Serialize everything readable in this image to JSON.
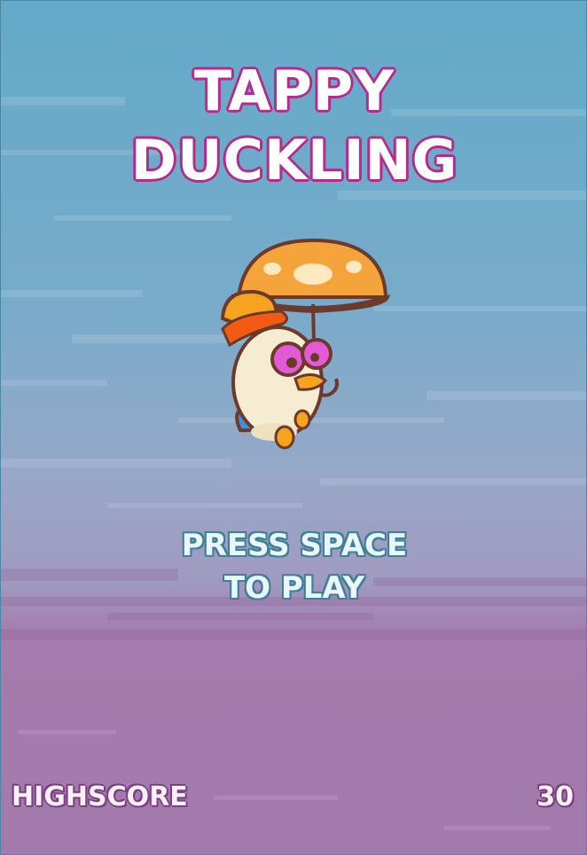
{
  "title": {
    "line1": "TAPPY",
    "line2": "DUCKLING"
  },
  "prompt": {
    "line1": "PRESS SPACE",
    "line2": "TO PLAY"
  },
  "hud": {
    "highscore_label": "HIGHSCORE",
    "highscore_value": "30"
  },
  "colors": {
    "sky_top": "#63a9c9",
    "sky_mid": "#95a9c9",
    "ground_purple": "#a27aab",
    "title_outline": "#b62a8a",
    "umbrella_orange": "#f4a43a",
    "duck_body": "#f6ecd2",
    "hat_orange": "#f6a320",
    "glasses_pink": "#e35ad6",
    "wing_blue": "#3d8fd8"
  },
  "icons": {
    "character": "duckling-with-umbrella-icon"
  }
}
